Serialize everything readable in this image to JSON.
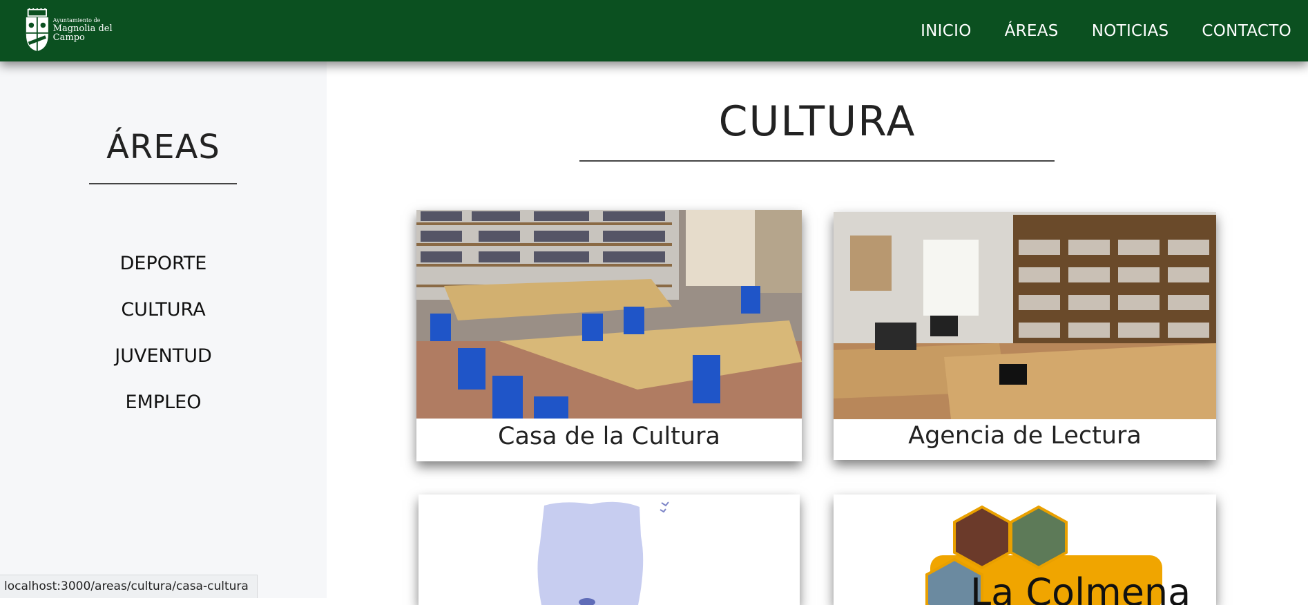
{
  "header": {
    "logo_small": "Ayuntamiento de",
    "logo_big": "Magnolia del Campo",
    "nav": [
      {
        "label": "INICIO"
      },
      {
        "label": "ÁREAS"
      },
      {
        "label": "NOTICIAS"
      },
      {
        "label": "CONTACTO"
      }
    ],
    "background_color": "#0b5020"
  },
  "sidebar": {
    "title": "ÁREAS",
    "items": [
      {
        "label": "DEPORTE"
      },
      {
        "label": "CULTURA"
      },
      {
        "label": "JUVENTUD"
      },
      {
        "label": "EMPLEO"
      }
    ]
  },
  "main": {
    "title": "CULTURA",
    "cards": [
      {
        "caption": "Casa de la Cultura",
        "image": "library-reading-room-photo"
      },
      {
        "caption": "Agencia de Lectura",
        "image": "library-office-photo"
      },
      {
        "caption": "",
        "image": "map-illustration"
      },
      {
        "caption": "",
        "image": "la-colmena-logo",
        "image_text": "La Colmena"
      }
    ]
  },
  "status_bar": {
    "url": "localhost:3000/areas/cultura/casa-cultura"
  }
}
